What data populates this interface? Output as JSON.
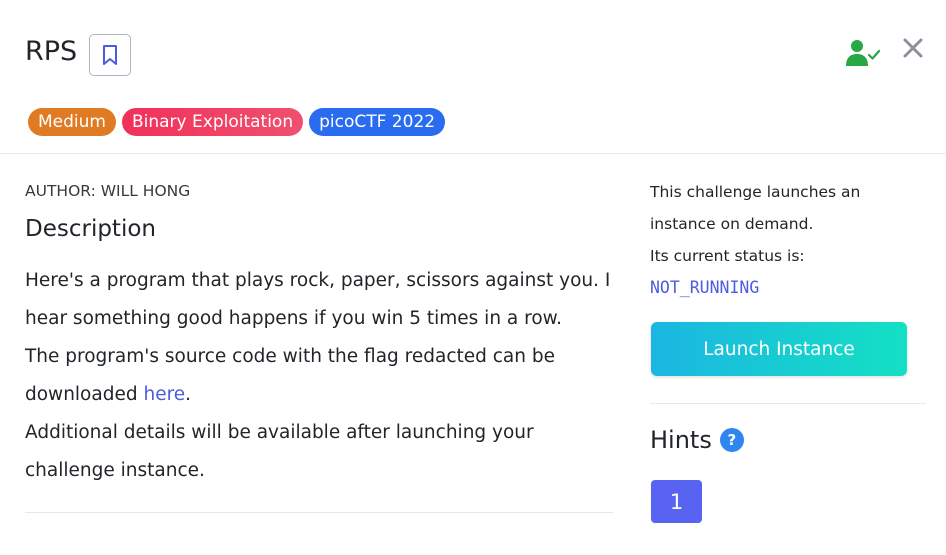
{
  "challenge": {
    "title": "RPS",
    "tags": {
      "difficulty": "Medium",
      "category": "Binary Exploitation",
      "event": "picoCTF 2022"
    },
    "author": "AUTHOR: WILL HONG",
    "description_heading": "Description",
    "description": {
      "line1": "Here's a program that plays rock, paper, scissors against you. I hear something good happens if you win 5 times in a row.",
      "line2_prefix": "The program's source code with the flag redacted can be downloaded ",
      "link_text": "here",
      "line2_suffix": ".",
      "line3": "Additional details will be available after launching your challenge instance."
    }
  },
  "instance": {
    "info_line1": "This challenge launches an instance on demand.",
    "info_line2": "Its current status is:",
    "status": "NOT_RUNNING",
    "launch_label": "Launch Instance"
  },
  "hints": {
    "heading": "Hints",
    "help_glyph": "?",
    "items": [
      "1"
    ]
  },
  "icons": {
    "bookmark": "bookmark-icon",
    "solved": "user-check-icon",
    "close": "close-icon"
  },
  "colors": {
    "medium": "#e07b24",
    "category": "#f2305a",
    "event": "#2a6cf0",
    "link": "#4d5bdf",
    "launch_start": "#1bb6e3",
    "launch_end": "#14e0c3",
    "hint": "#5863f2",
    "solved_green": "#28a745"
  }
}
